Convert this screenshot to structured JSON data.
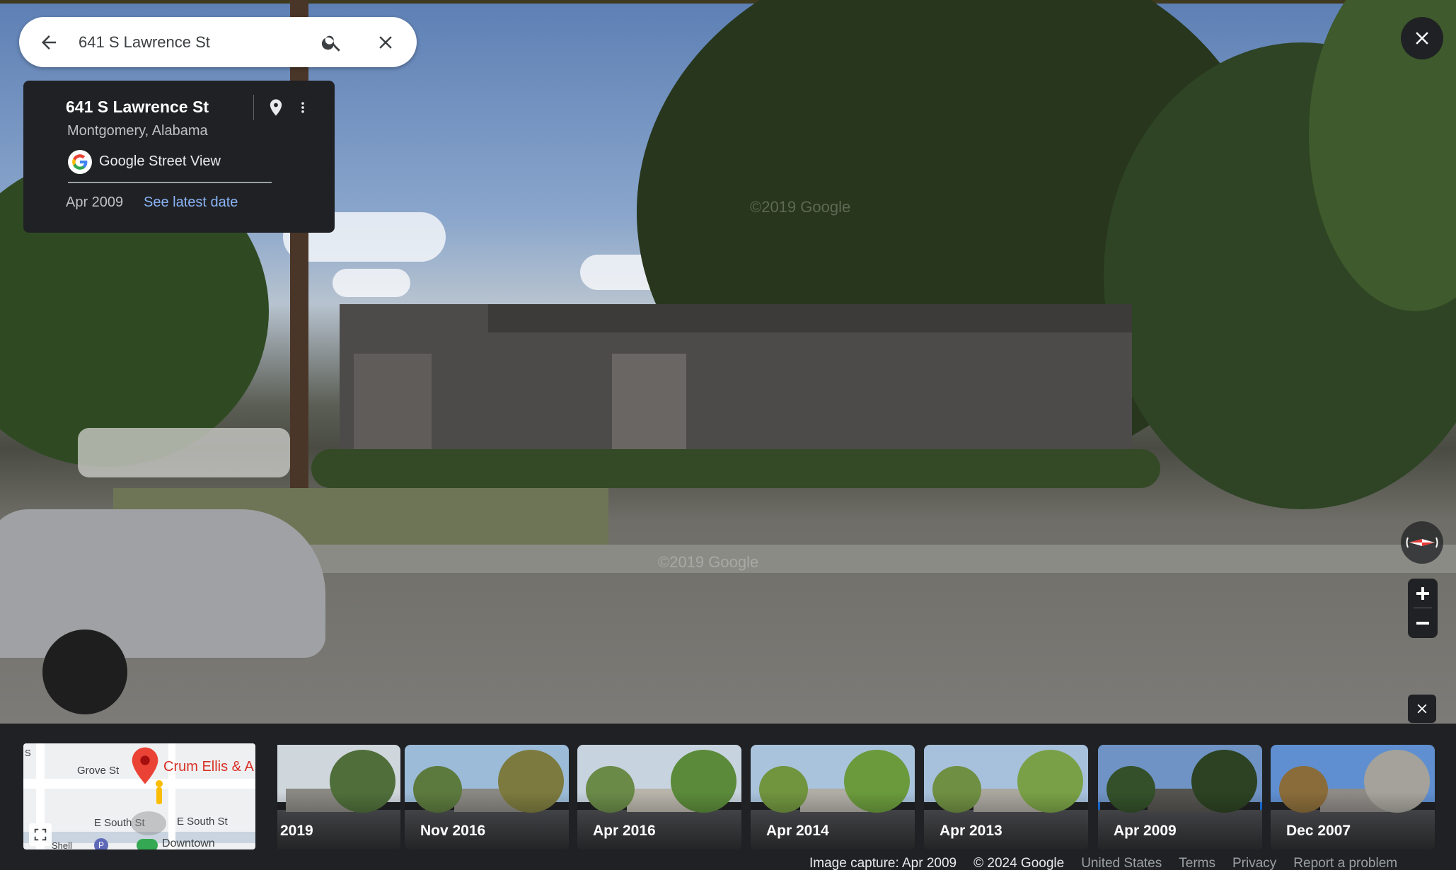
{
  "search": {
    "value": "641 S Lawrence St"
  },
  "info_card": {
    "title": "641 S Lawrence St",
    "subtitle": "Montgomery, Alabama",
    "provider": "Google Street View",
    "date": "Apr 2009",
    "latest_link": "See latest date"
  },
  "pano": {
    "watermark_1": "©2019 Google",
    "watermark_2": "©2019 Google"
  },
  "minimap": {
    "street_1": "Grove St",
    "street_2": "E South St",
    "street_3": "E South St",
    "place": "Crum Ellis & A",
    "area": "Downtown",
    "poi_badge": "P",
    "vertical_street": "S",
    "corner_label": "Shell"
  },
  "timeline": {
    "thumbs": [
      {
        "label": "2019"
      },
      {
        "label": "Nov 2016"
      },
      {
        "label": "Apr 2016"
      },
      {
        "label": "Apr 2014"
      },
      {
        "label": "Apr 2013"
      },
      {
        "label": "Apr 2009",
        "selected": true
      },
      {
        "label": "Dec 2007"
      }
    ]
  },
  "footer": {
    "capture": "Image capture: Apr 2009",
    "copyright": "© 2024 Google",
    "country": "United States",
    "terms": "Terms",
    "privacy": "Privacy",
    "report": "Report a problem"
  },
  "icons": {
    "back": "arrow-left-icon",
    "search": "search-icon",
    "clear": "close-icon",
    "pin": "map-pin-icon",
    "more": "more-vert-icon",
    "provider": "google-g-icon",
    "compass": "compass-icon",
    "zoom_in": "plus-icon",
    "zoom_out": "minus-icon",
    "expand": "fullscreen-icon"
  },
  "colors": {
    "panel": "#202124",
    "link": "#8ab4f8",
    "selected_outline": "#1a73e8"
  }
}
